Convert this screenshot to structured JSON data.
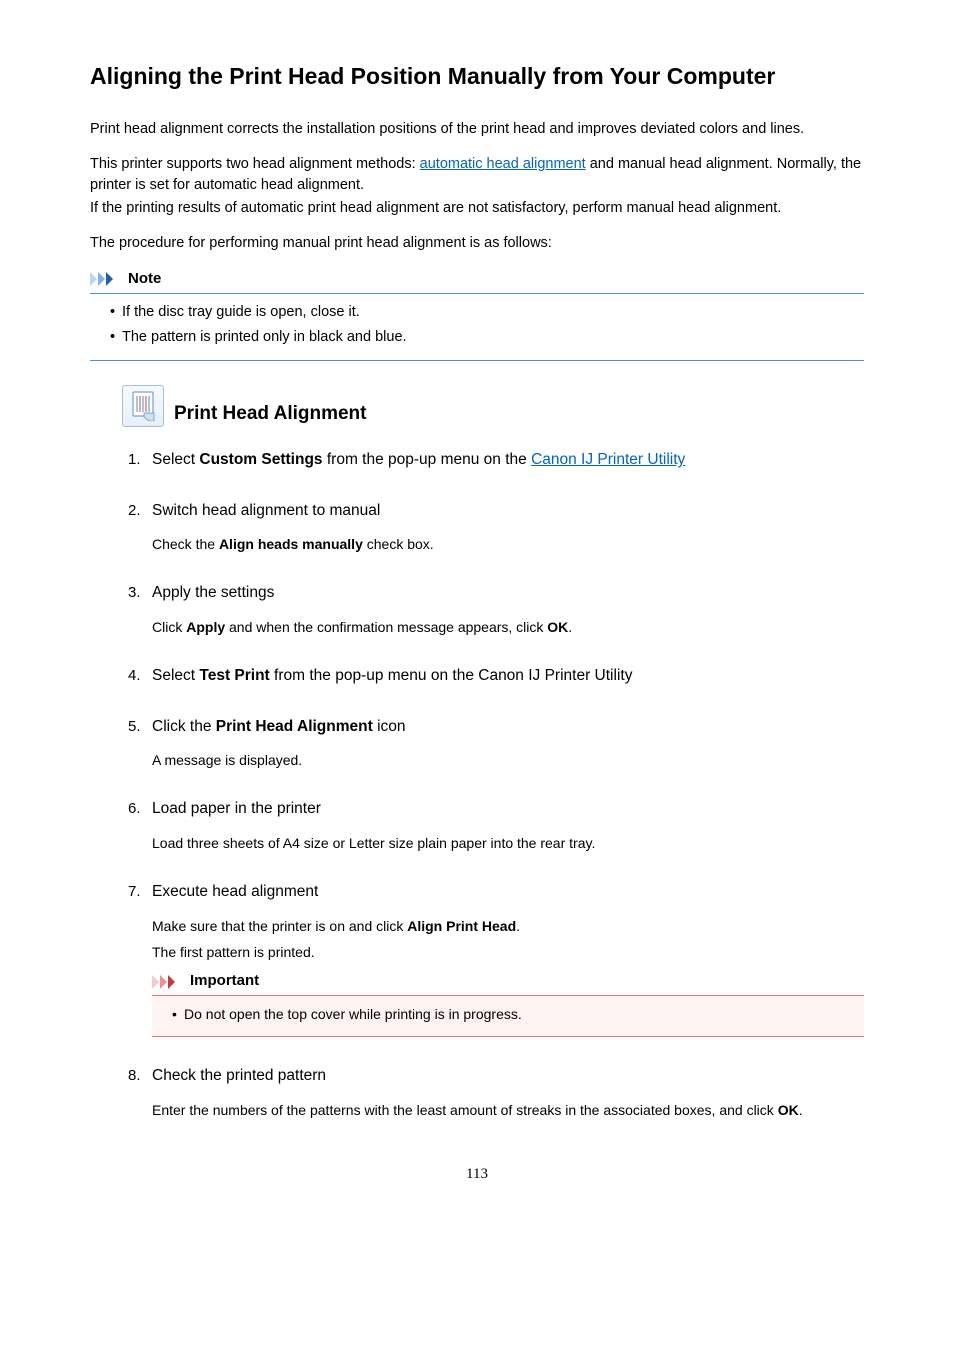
{
  "title": "Aligning the Print Head Position Manually from Your Computer",
  "intro1": "Print head alignment corrects the installation positions of the print head and improves deviated colors and lines.",
  "intro2_pre": "This printer supports two head alignment methods: ",
  "intro2_link": "automatic head alignment",
  "intro2_post": " and manual head alignment. Normally, the printer is set for automatic head alignment.",
  "intro3": "If the printing results of automatic print head alignment are not satisfactory, perform manual head alignment.",
  "intro4": "The procedure for performing manual print head alignment is as follows:",
  "note": {
    "label": "Note",
    "items": [
      "If the disc tray guide is open, close it.",
      "The pattern is printed only in black and blue."
    ]
  },
  "section": {
    "title": "Print Head Alignment",
    "steps": [
      {
        "title_pre": "Select ",
        "title_bold": "Custom Settings",
        "title_mid": " from the pop-up menu on the ",
        "title_link": "Canon IJ Printer Utility",
        "title_post": "",
        "body": []
      },
      {
        "title": "Switch head alignment to manual",
        "body_pre": "Check the ",
        "body_bold": "Align heads manually",
        "body_post": " check box."
      },
      {
        "title": "Apply the settings",
        "body_pre": "Click ",
        "body_bold": "Apply",
        "body_mid": " and when the confirmation message appears, click ",
        "body_bold2": "OK",
        "body_post": "."
      },
      {
        "title_pre": "Select ",
        "title_bold": "Test Print",
        "title_post": " from the pop-up menu on the Canon IJ Printer Utility"
      },
      {
        "title_pre": "Click the ",
        "title_bold": "Print Head Alignment",
        "title_post": " icon",
        "body_plain": "A message is displayed."
      },
      {
        "title": "Load paper in the printer",
        "body_plain": "Load three sheets of A4 size or Letter size plain paper into the rear tray."
      },
      {
        "title": "Execute head alignment",
        "body_pre": "Make sure that the printer is on and click ",
        "body_bold": "Align Print Head",
        "body_post": ".",
        "body_line2": "The first pattern is printed.",
        "important": {
          "label": "Important",
          "item": "Do not open the top cover while printing is in progress."
        }
      },
      {
        "title": "Check the printed pattern",
        "body_pre": "Enter the numbers of the patterns with the least amount of streaks in the associated boxes, and click ",
        "body_bold": "OK",
        "body_post": "."
      }
    ]
  },
  "page_number": "113"
}
